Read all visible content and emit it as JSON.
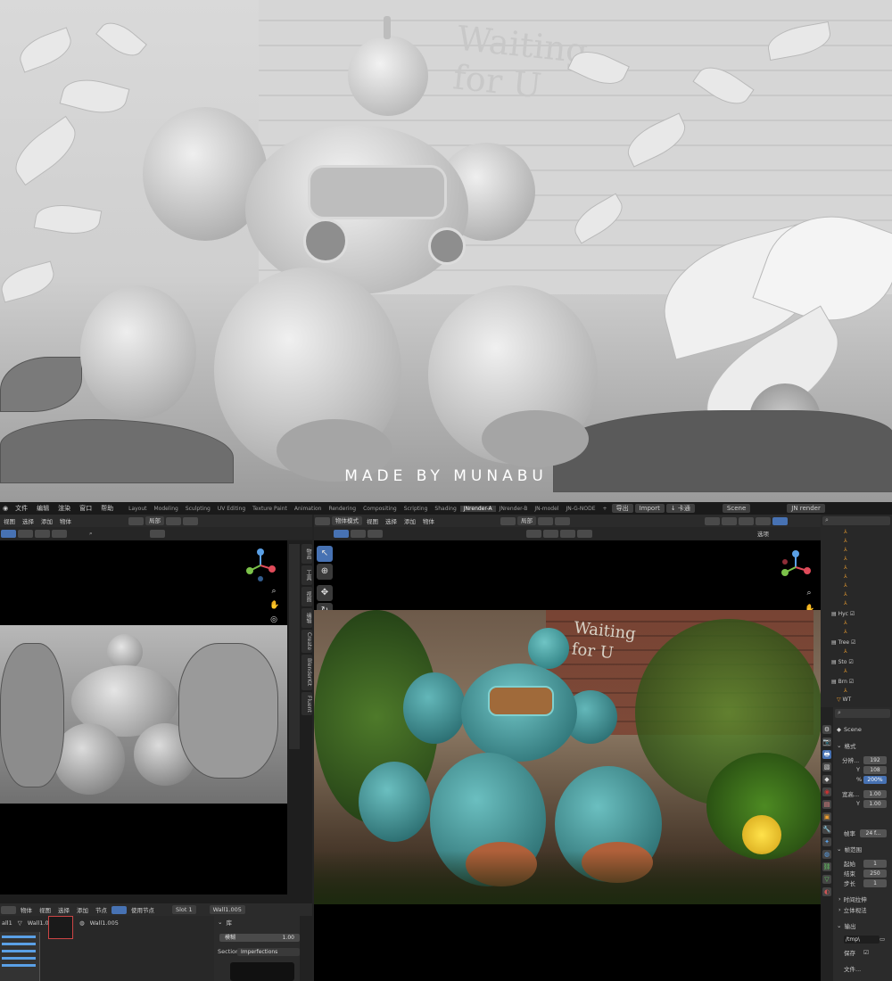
{
  "hero": {
    "credit": "MADE BY MUNABU",
    "wall_text_line1": "Waiting",
    "wall_text_line2": "for U"
  },
  "topbar": {
    "menus": [
      "文件",
      "编辑",
      "渲染",
      "窗口",
      "帮助"
    ],
    "workspaces": [
      "Layout",
      "Modeling",
      "Sculpting",
      "UV Editing",
      "Texture Paint",
      "Animation",
      "Rendering",
      "Compositing",
      "Scripting",
      "Shading",
      "JNrender-A",
      "JNrender-B",
      "JN-model",
      "JN-G-NODE"
    ],
    "active_workspace": "JNrender-A",
    "plus": "+",
    "export_btn": "导出",
    "import_btn": "Import",
    "export2_btn": "↓ 卡通",
    "scene_label": "Scene",
    "view_layer": "JN render"
  },
  "left_view": {
    "header_menus": [
      "视图",
      "选择",
      "添加",
      "物体"
    ],
    "pivot_label": "局部",
    "search_placeholder": ""
  },
  "right_view": {
    "mode": "物体模式",
    "header_menus": [
      "视图",
      "选择",
      "添加",
      "物体"
    ],
    "pivot_label": "局部",
    "options_label": "选项",
    "wall_text_line1": "Waiting",
    "wall_text_line2": "for U"
  },
  "n_panel_tabs": [
    "物品",
    "工具",
    "视图",
    "编辑",
    "Create",
    "BlenderKit",
    "Fluent"
  ],
  "shader_editor": {
    "header_menus": [
      "物体",
      "视图",
      "选择",
      "添加",
      "节点"
    ],
    "use_nodes_label": "使用节点",
    "slot": "Slot 1",
    "material": "Wall1.005",
    "breadcrumb": [
      "all1",
      "Wall1.001",
      "Wall1.005"
    ],
    "node_props_title": "库",
    "blend_label": "模糊",
    "blend_value": "1.00",
    "section_label": "Section",
    "section_value": "Imperfections"
  },
  "outliner": {
    "search_placeholder": "",
    "collections": [
      "Hyc",
      "Tree",
      "Sto",
      "Brn",
      "WT"
    ]
  },
  "properties": {
    "scene": "Scene",
    "format_title": "格式",
    "resolution_label": "分辨...",
    "res_x": "192",
    "res_y": "108",
    "res_pct": "200%",
    "aspect_label": "宽高...",
    "aspect_x": "1.00",
    "aspect_y": "1.00",
    "frame_rate_label": "帧率",
    "frame_rate": "24 f...",
    "frame_range_title": "帧范围",
    "frame_start_label": "起始",
    "frame_start": "1",
    "frame_end_label": "结束",
    "frame_end": "250",
    "frame_step_label": "步长",
    "frame_step": "1",
    "time_stretch": "时间拉伸",
    "stereo": "立体视法",
    "output_title": "输出",
    "output_path": "/tmp\\",
    "save_label": "保存",
    "file_label": "文件...",
    "y_label": "Y",
    "pct_label": "%"
  },
  "colors": {
    "accent": "#4772b3",
    "panel": "#2b2b2b",
    "background": "#1d1d1d",
    "viewport": "#000000",
    "robot_teal": "#2f8f95"
  }
}
